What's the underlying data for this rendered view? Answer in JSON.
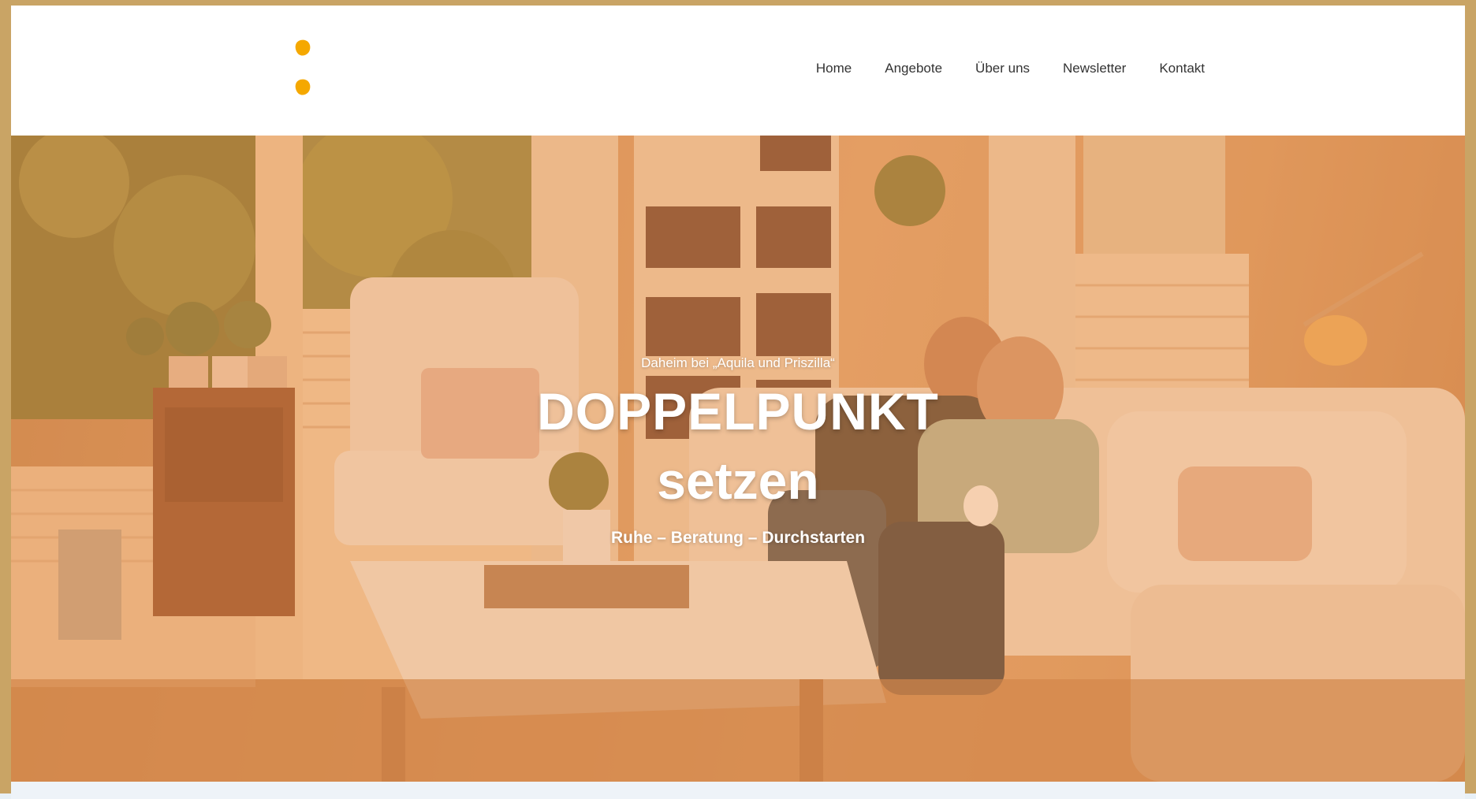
{
  "nav": {
    "items": [
      "Home",
      "Angebote",
      "Über uns",
      "Newsletter",
      "Kontakt"
    ]
  },
  "logo": {
    "icon": "colon-dots-logo",
    "color": "#f5a800"
  },
  "hero": {
    "tagline": "Daheim bei „Aquila und Priszilla“",
    "title_line1": "DOPPELPUNKT",
    "title_line2": "setzen",
    "subtitle": "Ruhe – Beratung – Durchstarten",
    "overlay_color": "#e68c46"
  },
  "frame": {
    "border_color": "#c9a465"
  }
}
